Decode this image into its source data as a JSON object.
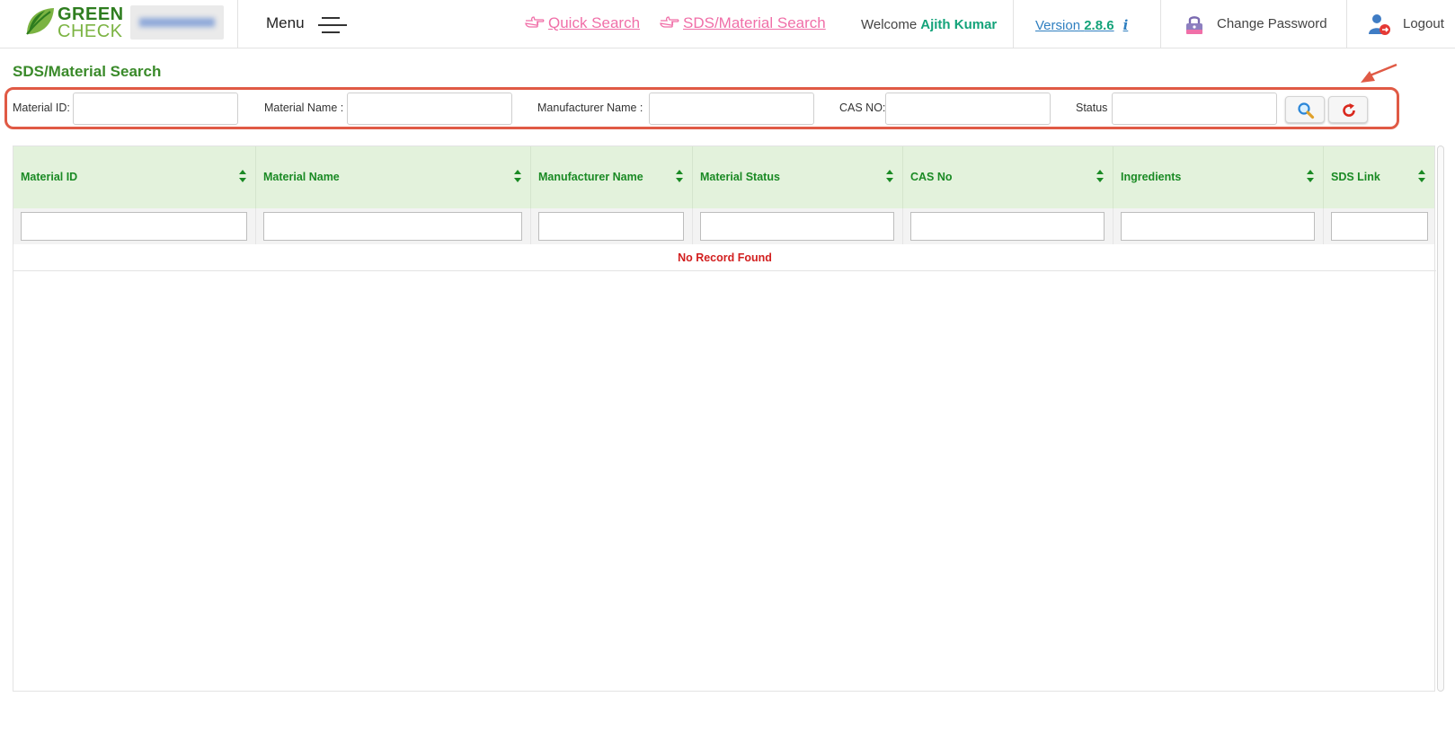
{
  "header": {
    "brand_line1": "GREEN",
    "brand_line2": "CHECK",
    "menu_label": "Menu",
    "quick_search": "Quick Search",
    "sds_search": "SDS/Material Search",
    "welcome_label": "Welcome",
    "user_name": "Ajith Kumar",
    "version_label": "Version",
    "version_number": "2.8.6",
    "info_glyph": "i",
    "change_password": "Change Password",
    "logout": "Logout"
  },
  "page": {
    "title": "SDS/Material Search"
  },
  "search": {
    "material_id_label": "Material ID:",
    "material_name_label": "Material Name :",
    "manufacturer_name_label": "Manufacturer Name :",
    "cas_no_label": "CAS NO:",
    "status_label": "Status"
  },
  "grid": {
    "columns": [
      "Material ID",
      "Material Name",
      "Manufacturer Name",
      "Material Status",
      "CAS No",
      "Ingredients",
      "SDS Link"
    ],
    "empty_message": "No Record Found"
  },
  "icons": {
    "brand": "leaf-icon",
    "menu": "hamburger-icon",
    "link": "pointing-hand-icon",
    "change_password": "lock-icon",
    "logout": "user-logout-icon",
    "search": "search-icon",
    "reset": "refresh-icon",
    "sort": "sort-icon",
    "annotation": "red-arrow-icon"
  },
  "colors": {
    "brand_dark": "#2e7d1f",
    "brand_light": "#7bb342",
    "link_pink": "#f06fa8",
    "user_green": "#14a37a",
    "version_blue": "#2f7fc0",
    "header_green": "#1a8a24",
    "grid_header_bg": "#e3f2dc",
    "highlight_red": "#e05a45",
    "empty_red": "#d21f1f"
  }
}
